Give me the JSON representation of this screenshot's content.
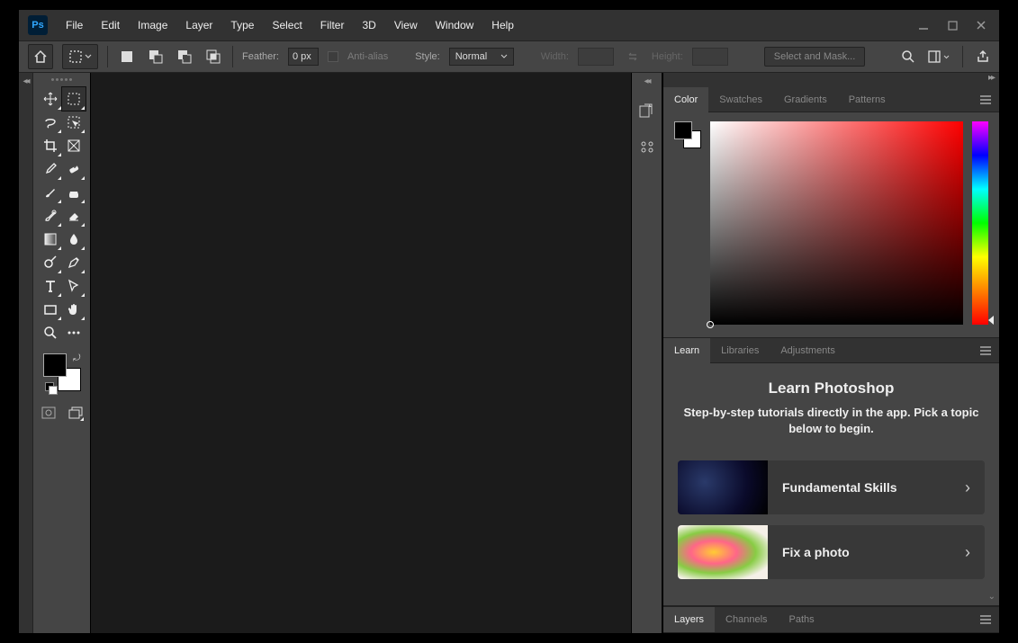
{
  "app": {
    "logo_text": "Ps"
  },
  "menus": [
    "File",
    "Edit",
    "Image",
    "Layer",
    "Type",
    "Select",
    "Filter",
    "3D",
    "View",
    "Window",
    "Help"
  ],
  "options": {
    "feather_label": "Feather:",
    "feather_value": "0 px",
    "antialias_label": "Anti-alias",
    "style_label": "Style:",
    "style_value": "Normal",
    "width_label": "Width:",
    "width_value": "",
    "height_label": "Height:",
    "height_value": "",
    "mask_label": "Select and Mask..."
  },
  "color_tabs": [
    "Color",
    "Swatches",
    "Gradients",
    "Patterns"
  ],
  "color_tab_active": 0,
  "learn_tabs": [
    "Learn",
    "Libraries",
    "Adjustments"
  ],
  "learn_tab_active": 0,
  "learn": {
    "title": "Learn Photoshop",
    "subtitle": "Step-by-step tutorials directly in the app. Pick a topic below to begin.",
    "cards": [
      {
        "label": "Fundamental Skills"
      },
      {
        "label": "Fix a photo"
      }
    ]
  },
  "layers_tabs": [
    "Layers",
    "Channels",
    "Paths"
  ],
  "layers_tab_active": 0,
  "colors": {
    "fg": "#000000",
    "bg": "#ffffff",
    "hue": "#ff0000"
  }
}
